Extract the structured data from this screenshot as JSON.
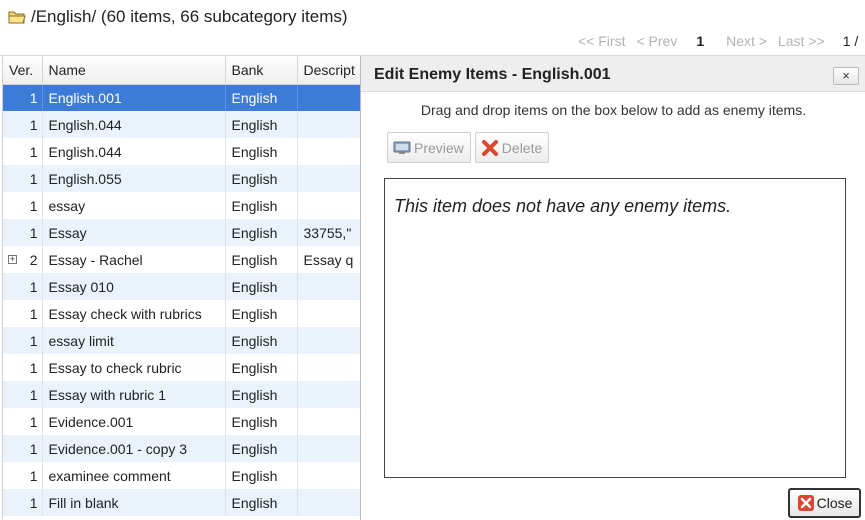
{
  "header": {
    "path": "/English/ (60 items, 66 subcategory items)",
    "pager": {
      "first": "<< First",
      "prev": "< Prev",
      "current": "1",
      "next": "Next >",
      "last": "Last >>",
      "page_partial": "1 /"
    }
  },
  "table": {
    "columns": [
      "Ver.",
      "Name",
      "Bank",
      "Descript"
    ],
    "rows": [
      {
        "ver": "1",
        "name": "English.001",
        "bank": "English",
        "desc": ""
      },
      {
        "ver": "1",
        "name": "English.044",
        "bank": "English",
        "desc": ""
      },
      {
        "ver": "1",
        "name": "English.044",
        "bank": "English",
        "desc": ""
      },
      {
        "ver": "1",
        "name": "English.055",
        "bank": "English",
        "desc": ""
      },
      {
        "ver": "1",
        "name": "essay",
        "bank": "English",
        "desc": ""
      },
      {
        "ver": "1",
        "name": "Essay",
        "bank": "English",
        "desc": "33755,\""
      },
      {
        "ver": "2",
        "name": "Essay - Rachel",
        "bank": "English",
        "desc": "Essay q"
      },
      {
        "ver": "1",
        "name": "Essay 010",
        "bank": "English",
        "desc": ""
      },
      {
        "ver": "1",
        "name": "Essay check with rubrics",
        "bank": "English",
        "desc": ""
      },
      {
        "ver": "1",
        "name": "essay limit",
        "bank": "English",
        "desc": ""
      },
      {
        "ver": "1",
        "name": "Essay to check rubric",
        "bank": "English",
        "desc": ""
      },
      {
        "ver": "1",
        "name": "Essay with rubric 1",
        "bank": "English",
        "desc": ""
      },
      {
        "ver": "1",
        "name": "Evidence.001",
        "bank": "English",
        "desc": ""
      },
      {
        "ver": "1",
        "name": "Evidence.001 - copy 3",
        "bank": "English",
        "desc": ""
      },
      {
        "ver": "1",
        "name": "examinee comment",
        "bank": "English",
        "desc": ""
      },
      {
        "ver": "1",
        "name": "Fill in blank",
        "bank": "English",
        "desc": ""
      }
    ],
    "selected_index": 0,
    "expandable_index": 6
  },
  "dialog": {
    "title": "Edit Enemy Items - English.001",
    "close_x": "×",
    "instructions": "Drag and drop items on the box below to add as enemy items.",
    "preview_label": "Preview",
    "delete_label": "Delete",
    "empty_message": "This item does not have any enemy items.",
    "close_label": "Close"
  },
  "colors": {
    "selected_row": "#3d7bd9",
    "alt_row": "#eaf2fb",
    "folder": "#e8c547",
    "delete_red": "#e0442c"
  },
  "icons": {
    "folder": "folder-icon",
    "preview": "monitor-icon",
    "delete": "red-x-icon",
    "close": "red-x-icon",
    "expander": "plus-box-icon"
  }
}
